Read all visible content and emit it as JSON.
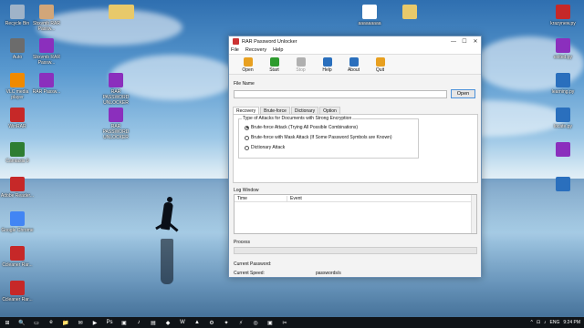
{
  "desktop": {
    "icons_left": [
      {
        "label": "Recycle Bin",
        "color": "#9fb3c8"
      },
      {
        "label": "Sbxvmb RAR Passw...",
        "color": "#d2a679"
      },
      {
        "label": "Auto",
        "color": "#6c6c6c"
      },
      {
        "label": "Sbxvmb RAR Passw...",
        "color": "#8b2fbd"
      },
      {
        "label": "VLC media player",
        "color": "#f08a00"
      },
      {
        "label": "RAR Passw...",
        "color": "#8b2fbd"
      },
      {
        "label": "WinRAR",
        "color": "#c62828"
      },
      {
        "label": "Camtasia 9",
        "color": "#2e7d32"
      },
      {
        "label": "Adobe Reader...",
        "color": "#c62828"
      },
      {
        "label": "Google Chrome",
        "color": "#4285f4"
      },
      {
        "label": "Ccleaner Rar...",
        "color": "#c62828"
      },
      {
        "label": "Ccleaner Rar...",
        "color": "#c62828"
      }
    ],
    "icons_mid": [
      {
        "label": "RAR PASSWORD UNLOCKER",
        "color": "#8b2fbd"
      },
      {
        "label": "RAR PASSWORD UNLOCKER",
        "color": "#8b2fbd"
      }
    ],
    "icons_right": [
      {
        "label": "krazynew.py",
        "color": "#c62828"
      },
      {
        "label": "exited.py",
        "color": "#8b2fbd"
      },
      {
        "label": "learning.py",
        "color": "#2a6fbd"
      },
      {
        "label": "locate.py",
        "color": "#2a6fbd"
      },
      {
        "label": "",
        "color": "#8b2fbd"
      },
      {
        "label": "",
        "color": "#2a6fbd"
      }
    ],
    "top_icons": [
      {
        "label": "",
        "color": "#e8c96a"
      },
      {
        "label": "",
        "color": "#e8c96a"
      },
      {
        "label": "aaaaaaaaa",
        "color": "#ffffff"
      },
      {
        "label": "",
        "color": "#e8c96a"
      }
    ]
  },
  "window": {
    "title": "RAR Password Unlocker",
    "controls": {
      "minimize": "—",
      "maximize": "☐",
      "close": "✕"
    },
    "menu": [
      "File",
      "Recovery",
      "Help"
    ],
    "toolbar": [
      {
        "label": "Open",
        "color": "#e8a020",
        "disabled": false
      },
      {
        "label": "Start",
        "color": "#2e9b2e",
        "disabled": false
      },
      {
        "label": "Stop",
        "color": "#b0b0b0",
        "disabled": true
      },
      {
        "label": "Help",
        "color": "#2a6fbd",
        "disabled": false
      },
      {
        "label": "About",
        "color": "#2a6fbd",
        "disabled": false
      },
      {
        "label": "Quit",
        "color": "#e8a020",
        "disabled": false
      }
    ],
    "file_name_label": "File Name",
    "file_name_value": "",
    "open_button": "Open",
    "tabs": [
      "Recovery",
      "Brute-force",
      "Dictionary",
      "Option"
    ],
    "active_tab": 0,
    "attack_group_title": "Type of Attacks for Documents with Strong Encryption",
    "attack_options": [
      {
        "label": "Brute-force Attack (Trying All Possible Combinations)",
        "checked": true
      },
      {
        "label": "Brute-force with Mask Attack (If Some Password Symbols are Known)",
        "checked": false
      },
      {
        "label": "Dictionary Attack",
        "checked": false
      }
    ],
    "log_window_label": "Log Window",
    "log_columns": [
      "Time",
      "Event"
    ],
    "process_label": "Process",
    "progress_fraction": 0,
    "current_password_label": "Current Password:",
    "current_password_value": "",
    "current_speed_label": "Current Speed:",
    "current_speed_value": "passwords/s"
  },
  "taskbar": {
    "items": [
      "⊞",
      "🔍",
      "▭",
      "e",
      "📁",
      "✉",
      "▶",
      "Ps",
      "▣",
      "♪",
      "▤",
      "◆",
      "W",
      "▲",
      "⚙",
      "✦",
      "⚡",
      "◎",
      "▣",
      "✂"
    ],
    "time": "9:24 PM",
    "tray_icons": [
      "^",
      "⊡",
      "♪",
      "ENG"
    ]
  }
}
